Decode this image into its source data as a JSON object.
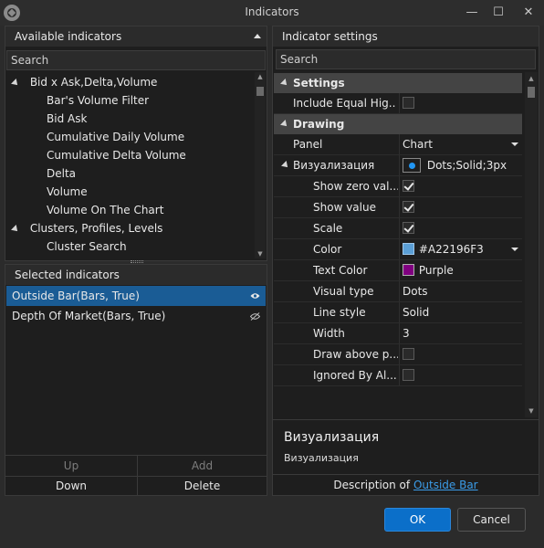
{
  "window": {
    "title": "Indicators",
    "minimize": "—",
    "maximize": "☐",
    "close": "✕"
  },
  "available": {
    "header": "Available indicators",
    "search_placeholder": "Search",
    "items": [
      {
        "label": "Bid x Ask,Delta,Volume",
        "group": true
      },
      {
        "label": "Bar's Volume Filter",
        "group": false
      },
      {
        "label": "Bid Ask",
        "group": false
      },
      {
        "label": "Cumulative Daily Volume",
        "group": false
      },
      {
        "label": "Cumulative Delta Volume",
        "group": false
      },
      {
        "label": "Delta",
        "group": false
      },
      {
        "label": "Volume",
        "group": false
      },
      {
        "label": "Volume On The Chart",
        "group": false
      },
      {
        "label": "Clusters, Profiles, Levels",
        "group": true
      },
      {
        "label": "Cluster Search",
        "group": false
      }
    ]
  },
  "selected": {
    "header": "Selected indicators",
    "items": [
      {
        "label": "Outside Bar(Bars, True)",
        "icon": "eye-icon"
      },
      {
        "label": "Depth Of Market(Bars, True)",
        "icon": "eye-hidden-icon"
      }
    ],
    "buttons": {
      "up": "Up",
      "add": "Add",
      "down": "Down",
      "delete": "Delete"
    }
  },
  "settings": {
    "header": "Indicator settings",
    "search_placeholder": "Search",
    "categories": {
      "settings": "Settings",
      "drawing": "Drawing"
    },
    "rows": {
      "include_equal": {
        "label": "Include Equal Hig..."
      },
      "panel": {
        "label": "Panel",
        "value": "Chart"
      },
      "visual": {
        "label": "Визуализация",
        "value": "Dots;Solid;3px"
      },
      "show_zero": {
        "label": "Show zero val..."
      },
      "show_value": {
        "label": "Show value"
      },
      "scale": {
        "label": "Scale"
      },
      "color": {
        "label": "Color",
        "value": "#A22196F3"
      },
      "text_color": {
        "label": "Text Color",
        "value": "Purple"
      },
      "visual_type": {
        "label": "Visual type",
        "value": "Dots"
      },
      "line_style": {
        "label": "Line style",
        "value": "Solid"
      },
      "width": {
        "label": "Width",
        "value": "3"
      },
      "draw_above": {
        "label": "Draw above p..."
      },
      "ignored_by": {
        "label": "Ignored By Al..."
      }
    },
    "description": {
      "title": "Визуализация",
      "text": "Визуализация",
      "footer_prefix": "Description of",
      "footer_link": "Outside Bar"
    }
  },
  "dialog": {
    "ok": "OK",
    "cancel": "Cancel"
  },
  "colors": {
    "accent": "#0b6fc9",
    "selection": "#1a5c95",
    "link": "#3b9ce8",
    "swatch_blue": "#2196F3",
    "swatch_purple": "#800080"
  }
}
